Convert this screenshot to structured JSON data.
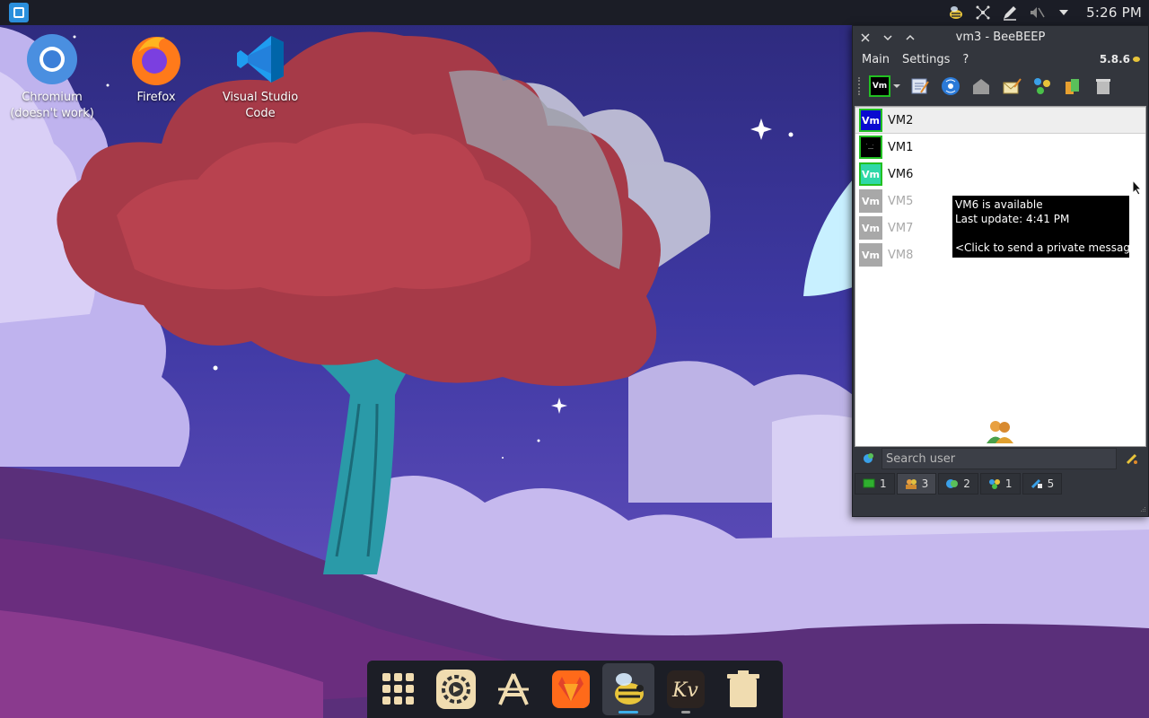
{
  "desktop": {
    "icons": [
      {
        "label_line1": "Chromium",
        "label_line2": "(doesn't work)"
      },
      {
        "label_line1": "Firefox"
      },
      {
        "label_line1": "Visual Studio",
        "label_line2": "Code"
      }
    ]
  },
  "topbar": {
    "clock": "5:26 PM",
    "tray_icons": [
      "beebeep-tray-icon",
      "network-icon",
      "pen-icon",
      "audio-muted-icon",
      "expand-tray-icon"
    ]
  },
  "window": {
    "title": "vm3 - BeeBEEP",
    "menu": {
      "main": "Main",
      "settings": "Settings",
      "help": "?"
    },
    "version": "5.8.6",
    "toolbar_icons": [
      "status-avatar-icon",
      "profile-edit-icon",
      "network-broadcast-icon",
      "home-icon",
      "message-icon",
      "plugins-icon",
      "files-icon",
      "trash-icon"
    ],
    "status_avatar_text": "Vm",
    "users": [
      {
        "avatar": "Vm",
        "name": "VM2",
        "color": "#0a0ad0",
        "border": "#22c022",
        "state": "online",
        "selected": true
      },
      {
        "avatar": "",
        "name": "VM1",
        "color": "#000000",
        "border": "#22c022",
        "state": "online",
        "selected": false
      },
      {
        "avatar": "Vm",
        "name": "VM6",
        "color": "#2fd8a8",
        "border": "#22c022",
        "state": "online",
        "selected": false
      },
      {
        "avatar": "Vm",
        "name": "VM5",
        "color": "#a8a8a8",
        "border": "#a8a8a8",
        "state": "offline",
        "selected": false
      },
      {
        "avatar": "Vm",
        "name": "VM7",
        "color": "#a8a8a8",
        "border": "#a8a8a8",
        "state": "offline",
        "selected": false
      },
      {
        "avatar": "Vm",
        "name": "VM8",
        "color": "#a8a8a8",
        "border": "#a8a8a8",
        "state": "offline",
        "selected": false
      }
    ],
    "search_placeholder": "Search user",
    "tabs": [
      {
        "icon": "chat-screen-icon",
        "count": "1",
        "active": false
      },
      {
        "icon": "users-icon",
        "count": "3",
        "active": true
      },
      {
        "icon": "groups-icon",
        "count": "2",
        "active": false
      },
      {
        "icon": "plugins-icon",
        "count": "1",
        "active": false
      },
      {
        "icon": "file-transfer-icon",
        "count": "5",
        "active": false
      }
    ]
  },
  "tooltip": {
    "line1": "VM6 is available",
    "line2": "Last update: 4:41 PM",
    "line3": "<Click to send a private message>"
  },
  "dock": {
    "items": [
      "app-grid-icon",
      "settings-icon",
      "app-store-icon",
      "gitlab-icon",
      "beebeep-icon",
      "kvantum-icon",
      "trash-icon"
    ]
  }
}
